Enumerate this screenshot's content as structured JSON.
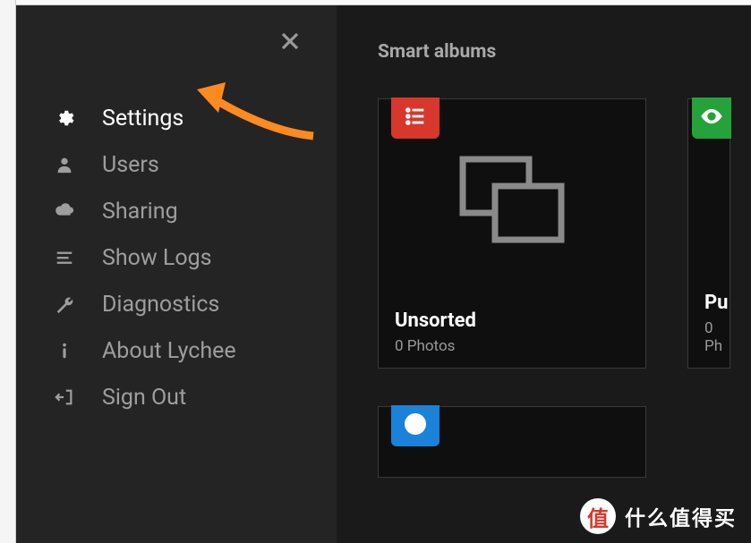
{
  "sidebar": {
    "items": [
      {
        "label": "Settings",
        "icon": "gear-icon",
        "active": true
      },
      {
        "label": "Users",
        "icon": "user-icon",
        "active": false
      },
      {
        "label": "Sharing",
        "icon": "cloud-icon",
        "active": false
      },
      {
        "label": "Show Logs",
        "icon": "bars-icon",
        "active": false
      },
      {
        "label": "Diagnostics",
        "icon": "wrench-icon",
        "active": false
      },
      {
        "label": "About Lychee",
        "icon": "info-icon",
        "active": false
      },
      {
        "label": "Sign Out",
        "icon": "signout-icon",
        "active": false
      }
    ]
  },
  "content": {
    "section_title": "Smart albums",
    "albums": [
      {
        "title": "Unsorted",
        "count": "0 Photos",
        "badge_color": "red",
        "badge_icon": "list"
      },
      {
        "title": "Pu",
        "count": "0 Ph",
        "badge_color": "green",
        "badge_icon": "eye"
      },
      {
        "title": "",
        "count": "",
        "badge_color": "blue",
        "badge_icon": "clock"
      }
    ]
  },
  "watermark": {
    "badge": "值",
    "text": "什么值得买"
  }
}
